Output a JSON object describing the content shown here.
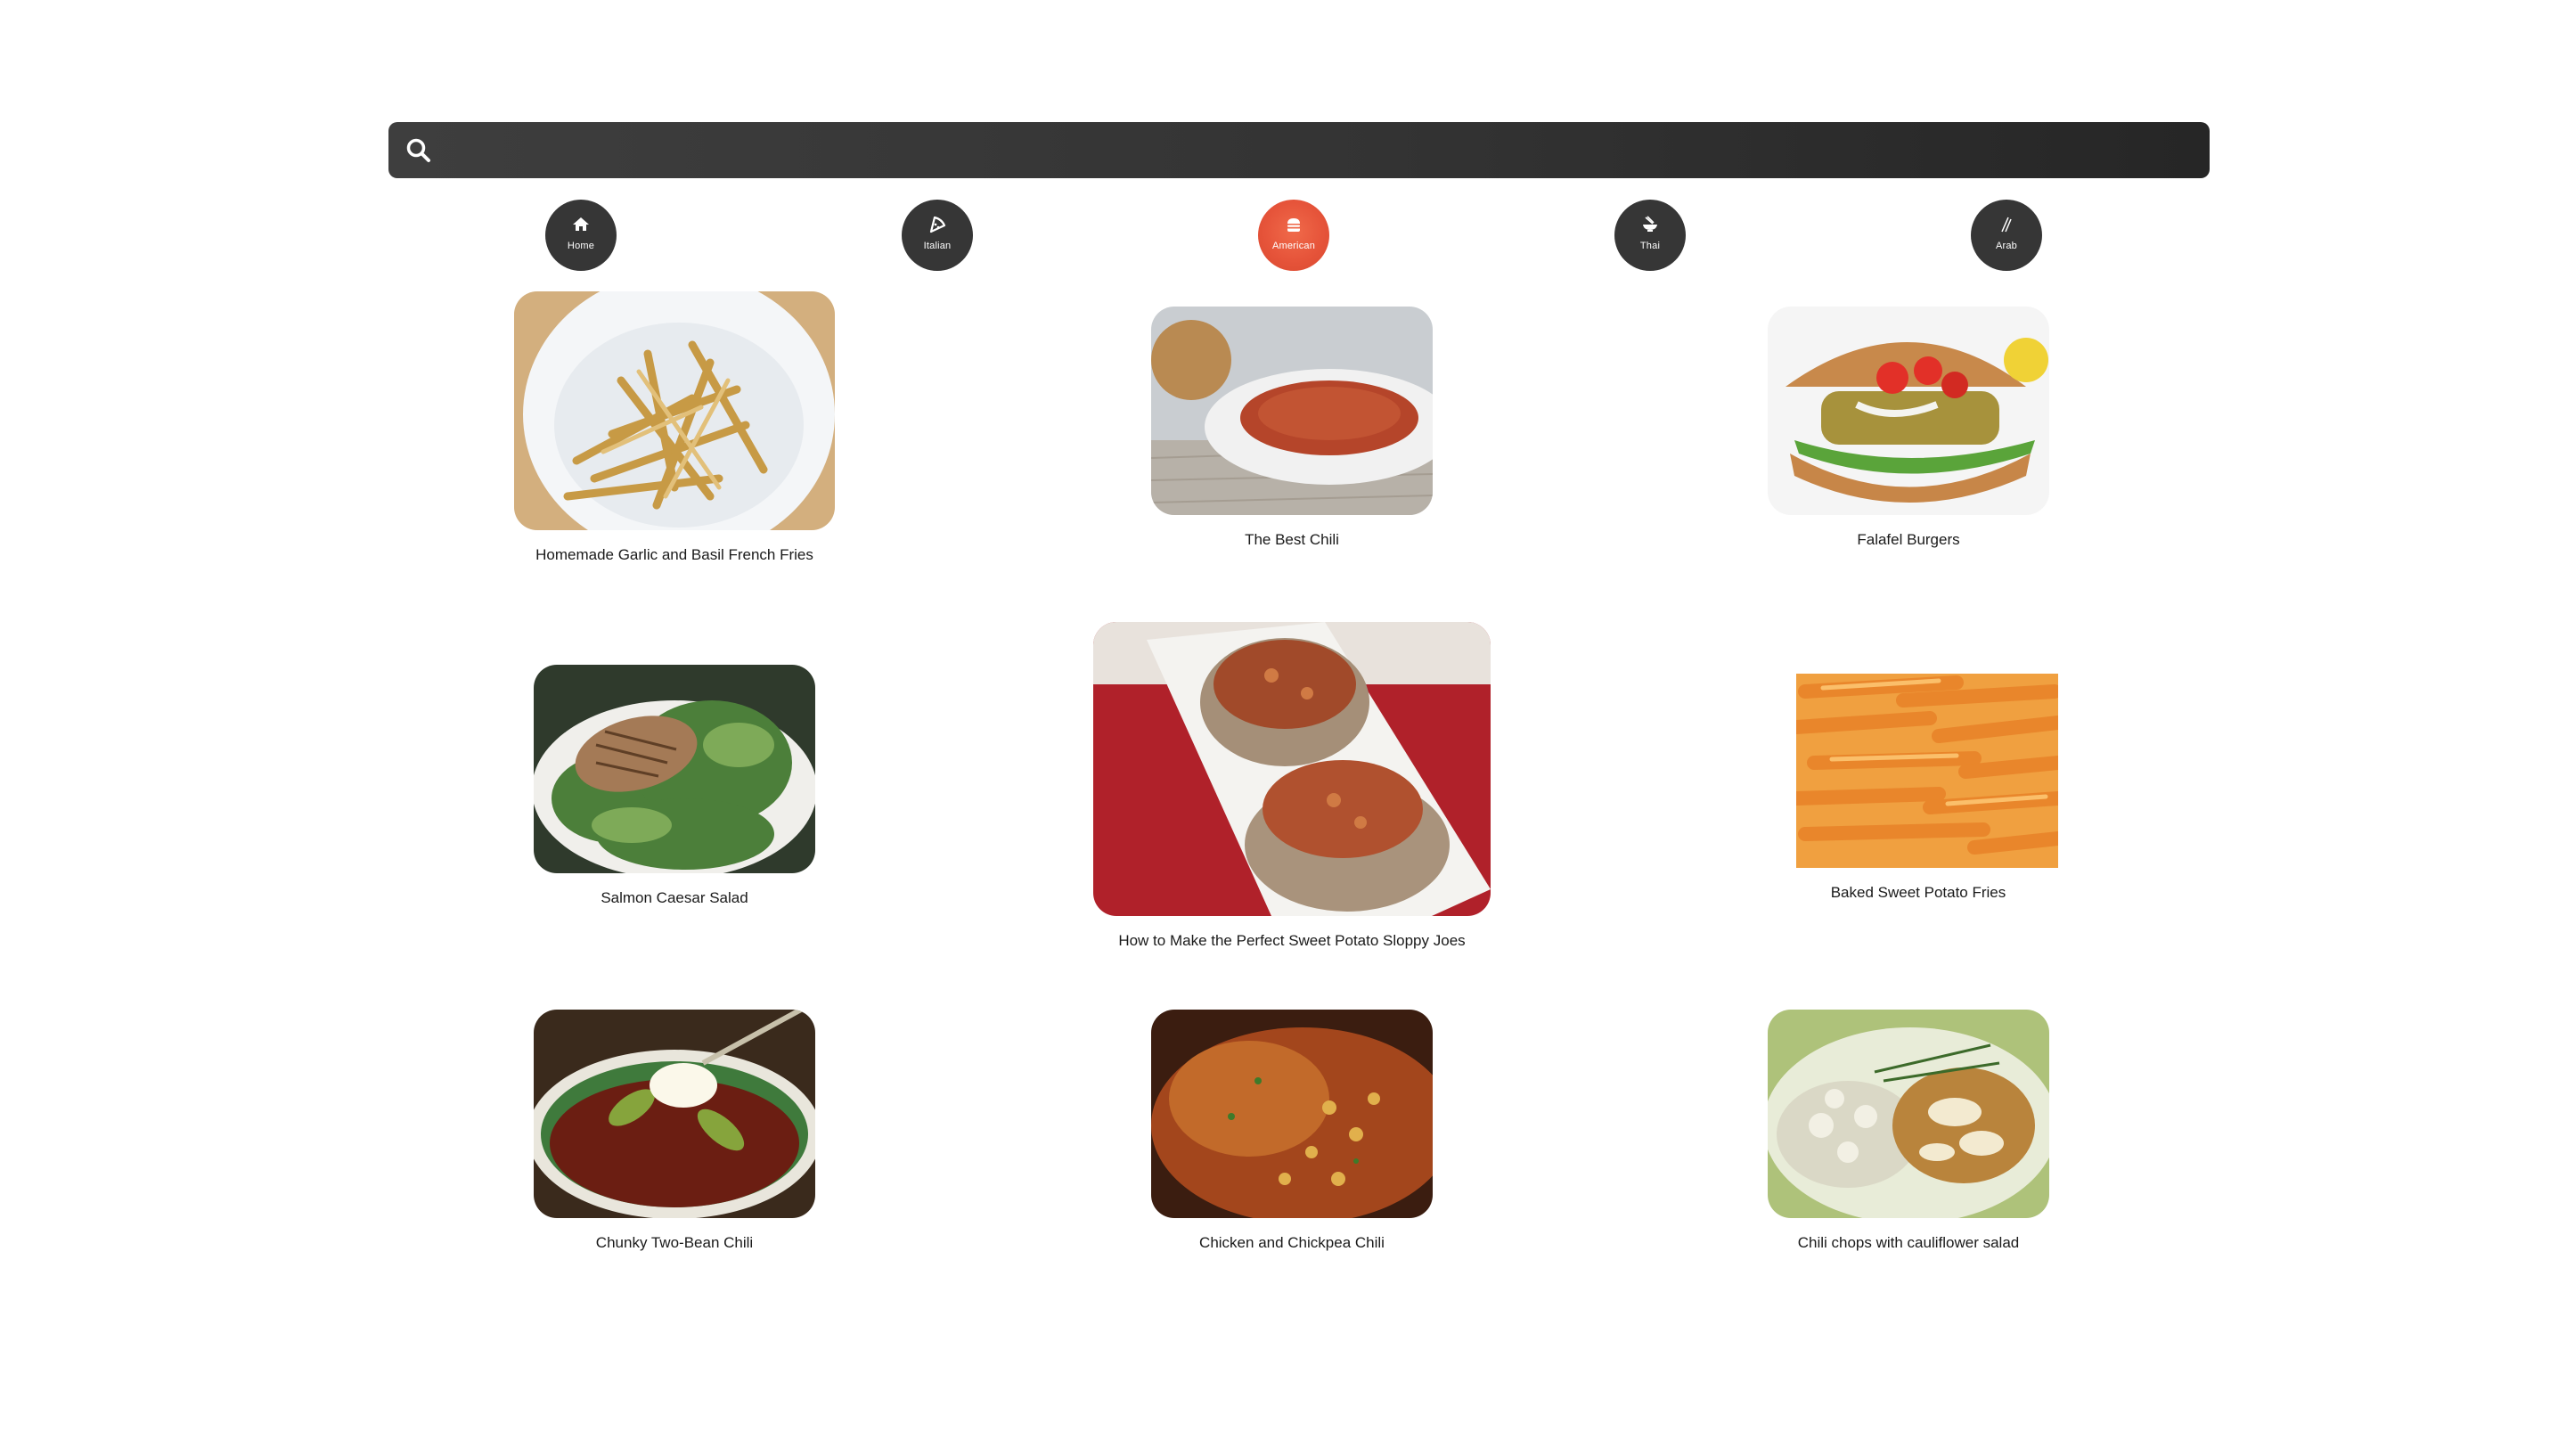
{
  "search": {
    "placeholder": "",
    "value": ""
  },
  "categories": [
    {
      "label": "Home",
      "icon": "home-icon",
      "active": false
    },
    {
      "label": "Italian",
      "icon": "pizza-icon",
      "active": false
    },
    {
      "label": "American",
      "icon": "burger-icon",
      "active": true
    },
    {
      "label": "Thai",
      "icon": "bowl-icon",
      "active": false
    },
    {
      "label": "Arab",
      "icon": "skewer-icon",
      "active": false
    }
  ],
  "colors": {
    "search_bg": "#333333",
    "category_bg": "#363636",
    "active_category": "#e6543a"
  },
  "recipes": [
    {
      "title": "Homemade Garlic and Basil French Fries"
    },
    {
      "title": "The Best Chili"
    },
    {
      "title": "Falafel Burgers"
    },
    {
      "title": "Salmon Caesar Salad"
    },
    {
      "title": "How to Make the Perfect Sweet Potato Sloppy Joes"
    },
    {
      "title": "Baked Sweet Potato Fries"
    },
    {
      "title": "Chunky Two-Bean Chili"
    },
    {
      "title": "Chicken and Chickpea Chili"
    },
    {
      "title": "Chili chops with cauliflower salad"
    }
  ]
}
